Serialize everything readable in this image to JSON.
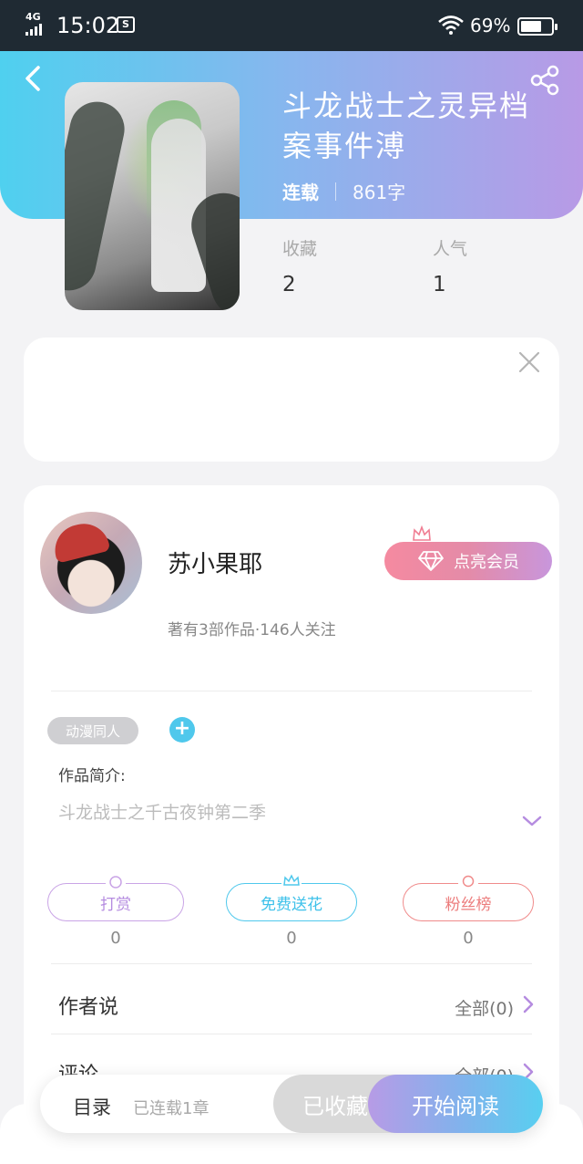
{
  "status_bar": {
    "network": "4G",
    "time": "15:02",
    "sync_icon_text": "S",
    "battery": "69%",
    "battery_level": 0.69
  },
  "header": {
    "back_icon": "back-arrow-icon",
    "share_icon": "share-icon",
    "gradient": [
      "#4fd0ef",
      "#b89ae6"
    ]
  },
  "book": {
    "title": "斗龙战士之灵异档案事件溥",
    "status": "连载",
    "word_count": "861字",
    "stats": [
      {
        "label": "收藏",
        "value": "2"
      },
      {
        "label": "人气",
        "value": "1"
      }
    ]
  },
  "ad": {
    "close_icon": "close-icon"
  },
  "author": {
    "name": "苏小果耶",
    "subtitle": "著有3部作品·146人关注",
    "vip_label": "点亮会员"
  },
  "work": {
    "tag": "动漫同人",
    "add_tag": "+",
    "intro_label": "作品简介:",
    "intro_text": "斗龙战士之千古夜钟第二季"
  },
  "actions": [
    {
      "label": "打赏",
      "count": "0"
    },
    {
      "label": "免费送花",
      "count": "0"
    },
    {
      "label": "粉丝榜",
      "count": "0"
    }
  ],
  "sections": [
    {
      "label": "作者说",
      "right": "全部(0)"
    },
    {
      "label": "评论",
      "right": "全部(0)"
    }
  ],
  "bottom": {
    "catalog": "目录",
    "chapters": "已连载1章",
    "collected": "已收藏",
    "read": "开始阅读"
  },
  "colors": {
    "accent_blue": "#4fc8ec",
    "accent_purple": "#b58ce0",
    "accent_red": "#ec7d7d"
  }
}
